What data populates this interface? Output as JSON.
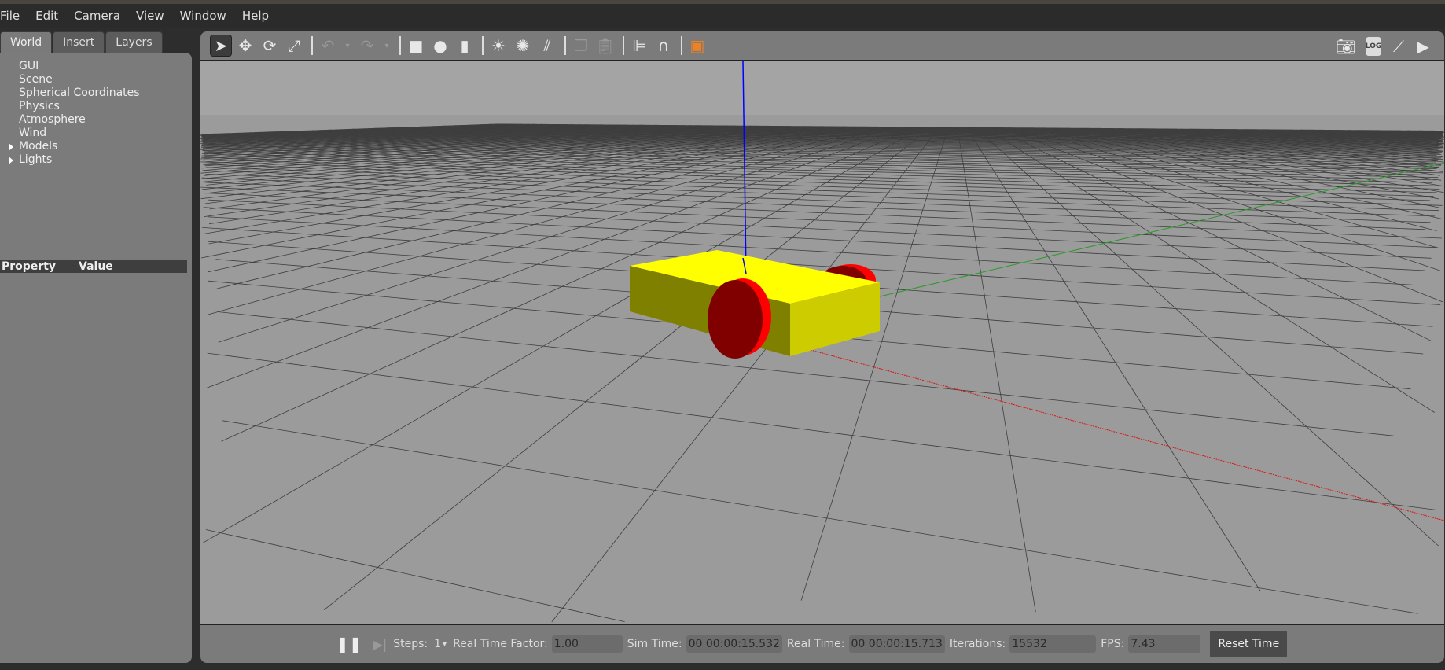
{
  "menu": [
    "File",
    "Edit",
    "Camera",
    "View",
    "Window",
    "Help"
  ],
  "left": {
    "tabs": [
      "World",
      "Insert",
      "Layers"
    ],
    "tree": [
      {
        "label": "GUI",
        "expandable": false
      },
      {
        "label": "Scene",
        "expandable": false
      },
      {
        "label": "Spherical Coordinates",
        "expandable": false
      },
      {
        "label": "Physics",
        "expandable": false
      },
      {
        "label": "Atmosphere",
        "expandable": false
      },
      {
        "label": "Wind",
        "expandable": false
      },
      {
        "label": "Models",
        "expandable": true
      },
      {
        "label": "Lights",
        "expandable": true
      }
    ],
    "property_header": "Property",
    "value_header": "Value"
  },
  "toolbar": {
    "right_log": "LOG"
  },
  "bottom": {
    "steps_label": "Steps:",
    "steps_value": "1",
    "rtf_label": "Real Time Factor:",
    "rtf": "1.00",
    "sim_label": "Sim Time:",
    "sim": "00 00:00:15.532",
    "real_label": "Real Time:",
    "real": "00 00:00:15.713",
    "iter_label": "Iterations:",
    "iter": "15532",
    "fps_label": "FPS:",
    "fps": "7.43",
    "reset": "Reset Time"
  },
  "colors": {
    "chassis_top": "#ffff00",
    "chassis_front": "#808000",
    "chassis_side": "#cccc00",
    "wheel": "#800000",
    "wheel_rim": "#ff0000",
    "ground": "#9b9b9b"
  }
}
